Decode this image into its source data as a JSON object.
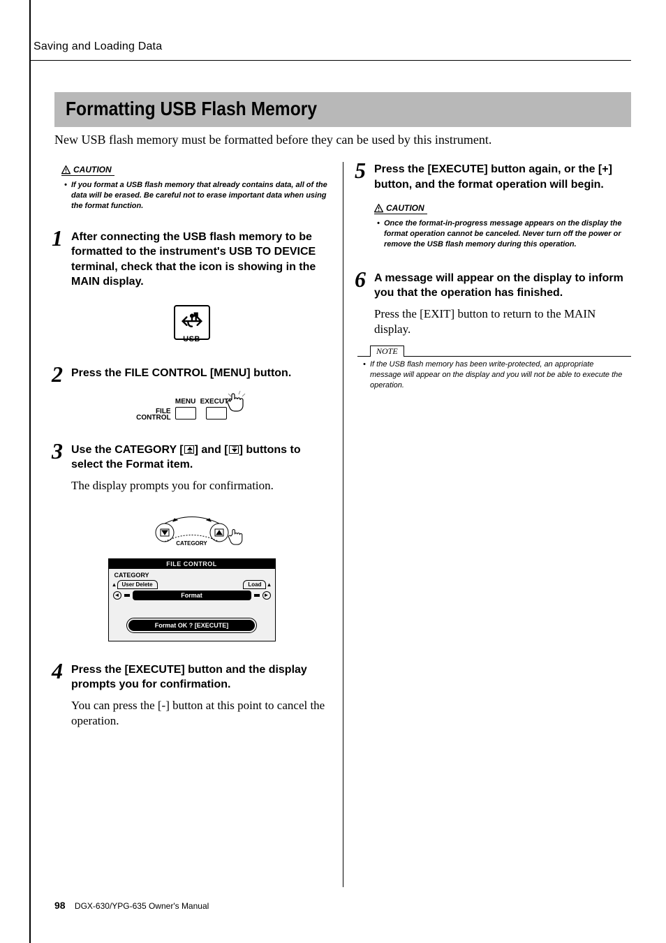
{
  "header": {
    "section": "Saving and Loading Data"
  },
  "title": "Formatting USB Flash Memory",
  "intro": "New USB flash memory must be formatted before they can be used by this instrument.",
  "caution_label": "CAUTION",
  "caution_top": "If you format a USB flash memory that already contains data, all of the data will be erased. Be careful not to erase important data when using the format function.",
  "steps": {
    "s1": {
      "num": "1",
      "head": "After connecting the USB flash memory to be formatted to the instrument's USB TO DEVICE terminal, check that the icon is showing in the MAIN display."
    },
    "s2": {
      "num": "2",
      "head": "Press the FILE CONTROL [MENU] button."
    },
    "s3": {
      "num": "3",
      "head_pre": "Use the CATEGORY [",
      "head_mid": "] and [",
      "head_post": "] buttons to select the Format item.",
      "body": "The display prompts you for confirmation."
    },
    "s4": {
      "num": "4",
      "head": "Press the [EXECUTE] button and the display prompts you for confirmation.",
      "body": "You can press the [-] button at this point to cancel the operation."
    },
    "s5": {
      "num": "5",
      "head": "Press the [EXECUTE] button again, or the [+] button, and the format operation will begin."
    },
    "s6": {
      "num": "6",
      "head": "A message will appear on the display to inform you that the operation has finished.",
      "body": "Press the [EXIT] button to return to the MAIN display."
    }
  },
  "caution_mid": "Once the format-in-progress message appears on the display the format operation cannot be canceled. Never turn off the power or remove the USB flash memory during this operation.",
  "note_label": "NOTE",
  "note_body": "If the USB flash memory has been write-protected, an appropriate message will appear on the display and you will not be able to execute the operation.",
  "panel": {
    "file_label": "FILE\nCONTROL",
    "menu": "MENU",
    "execute": "EXECUTE",
    "category": "CATEGORY"
  },
  "lcd": {
    "title": "FILE CONTROL",
    "category": "CATEGORY",
    "left_tab": "User Delete",
    "right_tab": "Load",
    "center": "Format",
    "confirm": "Format OK ? [EXECUTE]"
  },
  "usb_label": "USB",
  "footer": {
    "page": "98",
    "manual": "DGX-630/YPG-635  Owner's Manual"
  }
}
